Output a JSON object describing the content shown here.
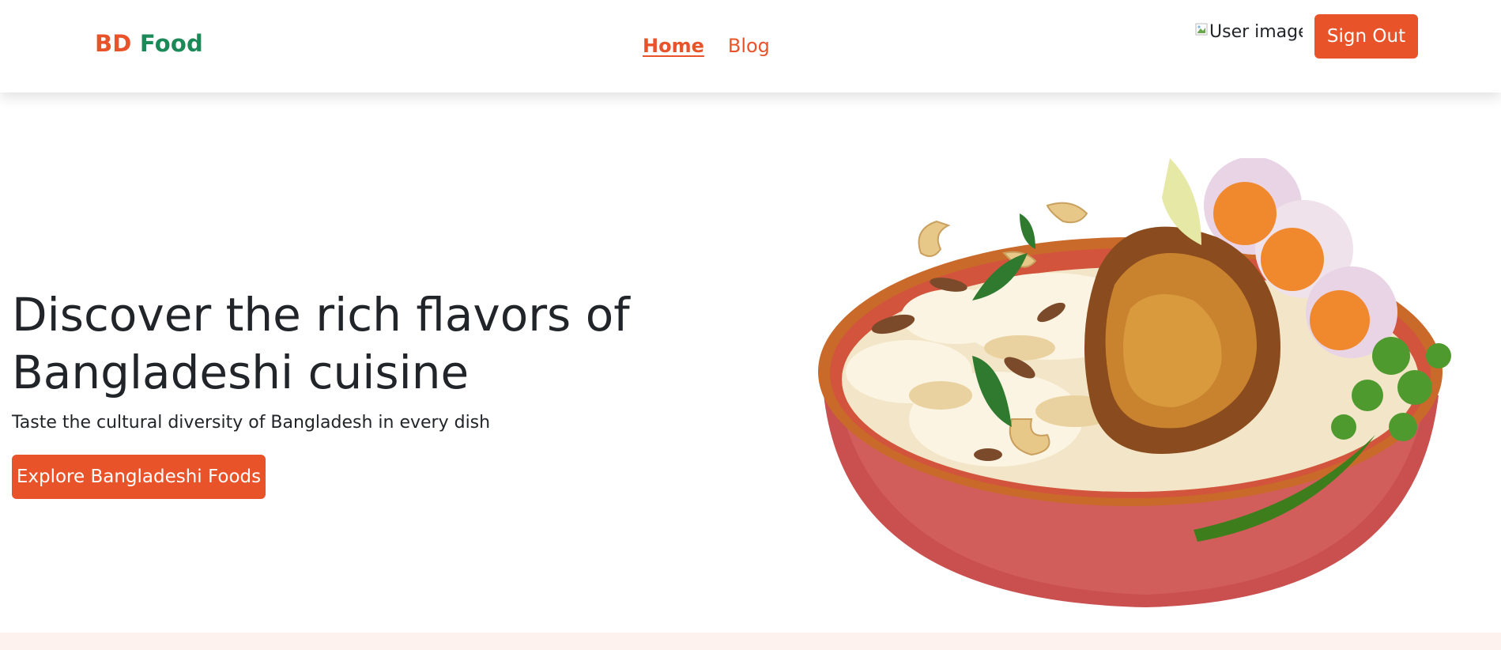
{
  "brand": {
    "part1": "BD",
    "part2": "Food"
  },
  "nav": {
    "home": "Home",
    "blog": "Blog"
  },
  "user": {
    "image_alt": "User image",
    "sign_out": "Sign Out"
  },
  "hero": {
    "title": "Discover the rich flavors of Bangladeshi cuisine",
    "subtitle": "Taste the cultural diversity of Bangladesh in every dish",
    "cta": "Explore Bangladeshi Foods"
  },
  "colors": {
    "accent": "#e8532a",
    "brand_green": "#1c8a58",
    "text": "#212529",
    "band": "#fdf2ee"
  }
}
